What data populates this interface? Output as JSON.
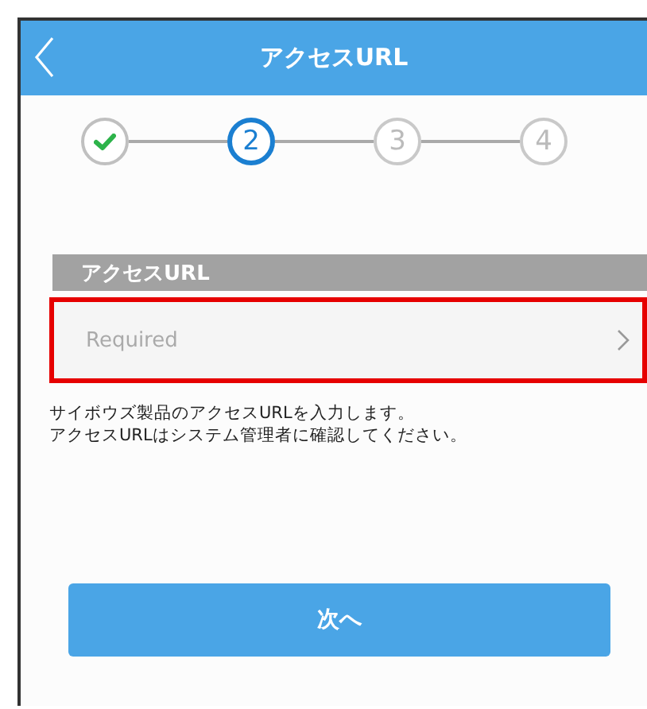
{
  "header": {
    "title": "アクセスURL"
  },
  "steps": [
    {
      "completed": true,
      "selected": false
    },
    {
      "completed": false,
      "selected": true,
      "label": "2"
    },
    {
      "completed": false,
      "selected": false,
      "label": "3"
    },
    {
      "completed": false,
      "selected": false,
      "label": "4"
    }
  ],
  "section": {
    "title": "アクセスURL"
  },
  "field": {
    "placeholder": "Required",
    "highlighted": true
  },
  "description": [
    "サイボウズ製品のアクセスURLを入力します。",
    "アクセスURLはシステム管理者に確認してください。"
  ],
  "next_button": "次へ"
}
